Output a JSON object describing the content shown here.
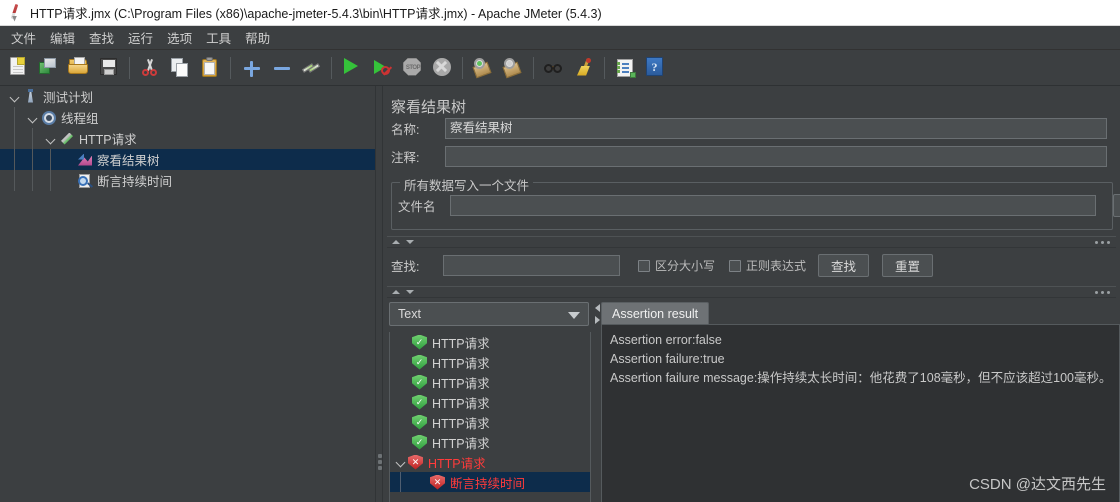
{
  "window": {
    "title": "HTTP请求.jmx (C:\\Program Files (x86)\\apache-jmeter-5.4.3\\bin\\HTTP请求.jmx) - Apache JMeter (5.4.3)",
    "app_icon": "jmeter-feather-icon"
  },
  "menu": {
    "items": [
      {
        "label": "文件"
      },
      {
        "label": "编辑"
      },
      {
        "label": "查找"
      },
      {
        "label": "运行"
      },
      {
        "label": "选项"
      },
      {
        "label": "工具"
      },
      {
        "label": "帮助"
      }
    ]
  },
  "toolbar": {
    "buttons": [
      {
        "icon": "new-document-icon"
      },
      {
        "icon": "templates-icon"
      },
      {
        "icon": "open-folder-icon"
      },
      {
        "icon": "save-icon"
      },
      {
        "icon": "cut-icon"
      },
      {
        "icon": "copy-icon"
      },
      {
        "icon": "paste-icon"
      },
      {
        "icon": "expand-all-plus-icon"
      },
      {
        "icon": "collapse-all-minus-icon"
      },
      {
        "icon": "toggle-enable-icon"
      },
      {
        "icon": "start-play-icon"
      },
      {
        "icon": "start-no-pauses-icon"
      },
      {
        "icon": "stop-icon"
      },
      {
        "icon": "shutdown-icon"
      },
      {
        "icon": "clear-icon"
      },
      {
        "icon": "clear-all-icon"
      },
      {
        "icon": "search-binoculars-icon"
      },
      {
        "icon": "reset-search-broom-icon"
      },
      {
        "icon": "function-helper-icon"
      },
      {
        "icon": "help-icon"
      }
    ]
  },
  "tree": {
    "nodes": [
      {
        "label": "测试计划",
        "icon": "test-plan-icon",
        "depth": 0,
        "expanded": true,
        "selected": false
      },
      {
        "label": "线程组",
        "icon": "thread-group-gear-icon",
        "depth": 1,
        "expanded": true,
        "selected": false
      },
      {
        "label": "HTTP请求",
        "icon": "http-request-pipette-icon",
        "depth": 2,
        "expanded": true,
        "selected": false
      },
      {
        "label": "察看结果树",
        "icon": "view-results-tree-icon",
        "depth": 3,
        "expanded": false,
        "selected": true
      },
      {
        "label": "断言持续时间",
        "icon": "duration-assertion-icon",
        "depth": 3,
        "expanded": false,
        "selected": false
      }
    ]
  },
  "panel": {
    "title": "察看结果树",
    "name_label": "名称:",
    "name_value": "察看结果树",
    "comment_label": "注释:",
    "comment_value": "",
    "file_group_title": "所有数据写入一个文件",
    "filename_label": "文件名",
    "filename_value": "",
    "browse_label": ""
  },
  "search": {
    "label": "查找:",
    "value": "",
    "case_sensitive_label": "区分大小写",
    "case_sensitive_checked": false,
    "regex_label": "正则表达式",
    "regex_checked": false,
    "find_button": "查找",
    "reset_button": "重置"
  },
  "results": {
    "render_selector": "Text",
    "items": [
      {
        "label": "HTTP请求",
        "status": "ok",
        "depth": 1,
        "expanded": false,
        "selected": false
      },
      {
        "label": "HTTP请求",
        "status": "ok",
        "depth": 1,
        "expanded": false,
        "selected": false
      },
      {
        "label": "HTTP请求",
        "status": "ok",
        "depth": 1,
        "expanded": false,
        "selected": false
      },
      {
        "label": "HTTP请求",
        "status": "ok",
        "depth": 1,
        "expanded": false,
        "selected": false
      },
      {
        "label": "HTTP请求",
        "status": "ok",
        "depth": 1,
        "expanded": false,
        "selected": false
      },
      {
        "label": "HTTP请求",
        "status": "ok",
        "depth": 1,
        "expanded": false,
        "selected": false
      },
      {
        "label": "HTTP请求",
        "status": "fail",
        "depth": 0,
        "expanded": true,
        "selected": false
      },
      {
        "label": "断言持续时间",
        "status": "fail",
        "depth": 2,
        "expanded": false,
        "selected": true
      }
    ]
  },
  "detail": {
    "tab_label": "Assertion result",
    "lines": [
      "Assertion error:false",
      "Assertion failure:true",
      "Assertion failure message:操作持续太长时间：他花费了108毫秒，但不应该超过100毫秒。"
    ]
  },
  "watermark": {
    "text": "CSDN @达文西先生"
  },
  "colors": {
    "window_bg": "#3c3f41",
    "titlebar_bg": "#ffffff",
    "selection_blue": "#0d2c4b",
    "fail_red": "#ff3b3b",
    "success_green": "#2f9e3f",
    "text": "#cfcfcf"
  }
}
